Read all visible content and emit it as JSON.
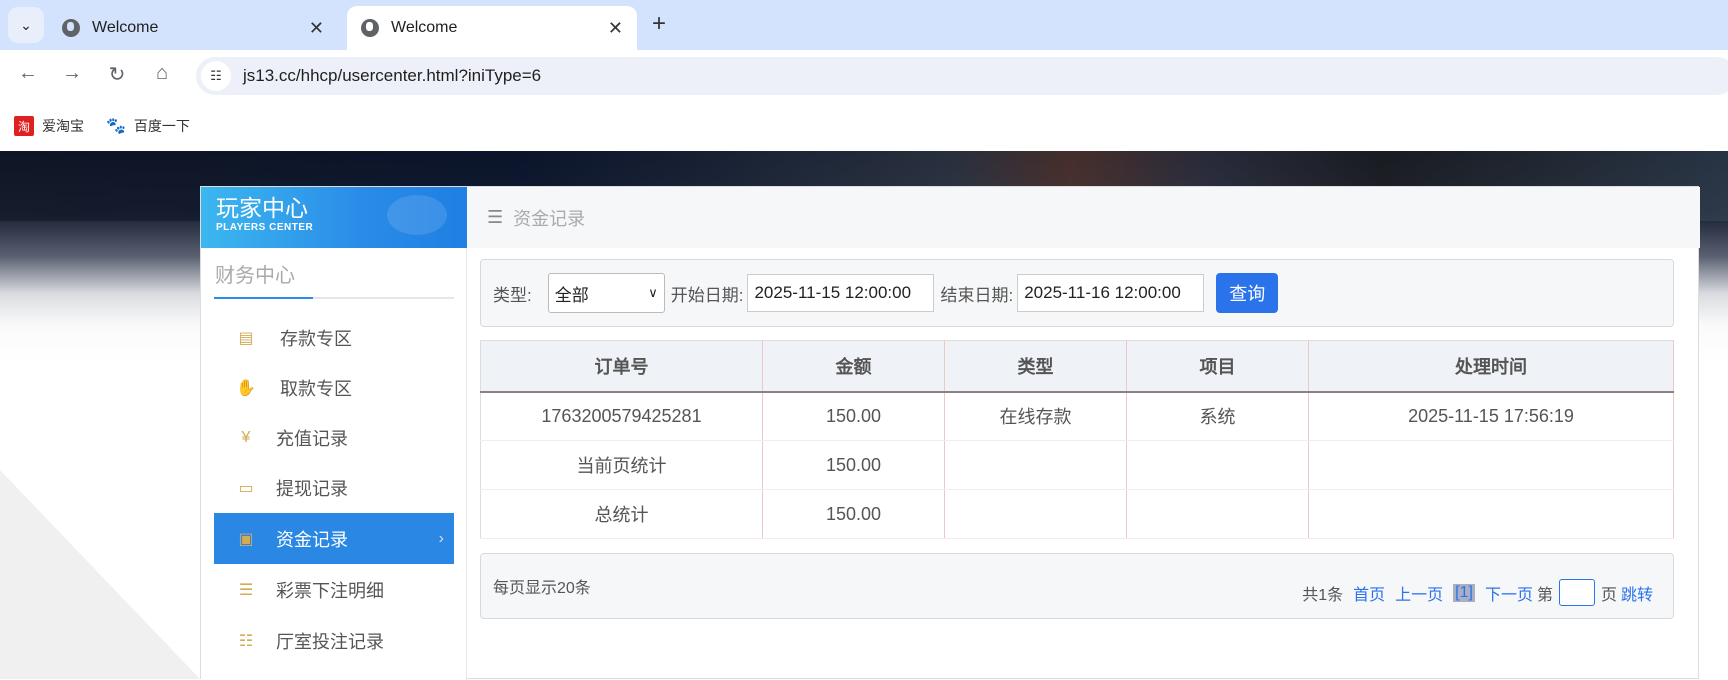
{
  "browser": {
    "tabs": [
      {
        "title": "Welcome",
        "active": false
      },
      {
        "title": "Welcome",
        "active": true
      }
    ],
    "url": "js13.cc/hhcp/usercenter.html?iniType=6",
    "bookmarks": [
      {
        "label": "爱淘宝",
        "icon": "taobao-icon"
      },
      {
        "label": "百度一下",
        "icon": "baidu-paw-icon"
      }
    ]
  },
  "sidebar": {
    "logo_cn": "玩家中心",
    "logo_en": "PLAYERS CENTER",
    "section_title": "财务中心",
    "items": [
      {
        "label": "存款专区",
        "icon": "card-icon"
      },
      {
        "label": "取款专区",
        "icon": "hand-cash-icon"
      },
      {
        "label": "充值记录",
        "icon": "money-bag-icon"
      },
      {
        "label": "提现记录",
        "icon": "wallet-icon"
      },
      {
        "label": "资金记录",
        "icon": "cash-icon",
        "active": true
      },
      {
        "label": "彩票下注明细",
        "icon": "list-icon"
      },
      {
        "label": "厅室投注记录",
        "icon": "bullet-list-icon"
      }
    ]
  },
  "main": {
    "header": "资金记录",
    "filter": {
      "type_label": "类型:",
      "type_value": "全部",
      "start_label": "开始日期:",
      "start_value": "2025-11-15 12:00:00",
      "end_label": "结束日期:",
      "end_value": "2025-11-16 12:00:00",
      "query": "查询"
    },
    "table": {
      "headers": [
        "订单号",
        "金额",
        "类型",
        "项目",
        "处理时间"
      ],
      "rows": [
        [
          "176320057942528​1",
          "150.00",
          "在线存款",
          "系统",
          "2025-11-15 17:56:19"
        ],
        [
          "当前页统计",
          "150.00",
          "",
          "",
          ""
        ],
        [
          "总统计",
          "150.00",
          "",
          "",
          ""
        ]
      ]
    },
    "pager": {
      "per_page": "每页显示20条",
      "total": "共1条",
      "first": "首页",
      "prev": "上一页",
      "current": "[1]",
      "next": "下一页",
      "page_prefix": "第",
      "page_suffix": "页",
      "go": "跳转"
    }
  },
  "colors": {
    "accent": "#2b73ea",
    "sidebar_active": "#2a88e4",
    "icon_gold": "#d4aa55"
  }
}
